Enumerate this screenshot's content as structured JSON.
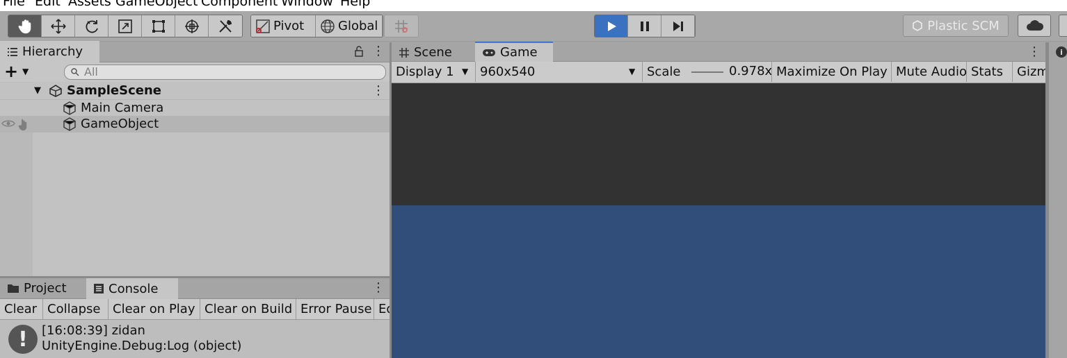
{
  "menu": [
    "File",
    "Edit",
    "Assets",
    "GameObject",
    "Component",
    "Window",
    "Help"
  ],
  "toolbar": {
    "tools": [
      "hand-tool",
      "move-tool",
      "rotate-tool",
      "scale-tool",
      "rect-tool",
      "transform-tool",
      "custom-tool"
    ],
    "pivot_label": "Pivot",
    "global_label": "Global",
    "plastic_label": "Plastic SCM"
  },
  "hierarchy": {
    "tab_label": "Hierarchy",
    "search_placeholder": "All",
    "scene_name": "SampleScene",
    "items": [
      {
        "label": "Main Camera"
      },
      {
        "label": "GameObject"
      }
    ]
  },
  "bottom": {
    "tabs": [
      {
        "label": "Project"
      },
      {
        "label": "Console"
      }
    ],
    "console_buttons": [
      "Clear",
      "Collapse",
      "Clear on Play",
      "Clear on Build",
      "Error Pause",
      "Ed"
    ],
    "log": {
      "line1": "[16:08:39] zidan",
      "line2": "UnityEngine.Debug:Log (object)"
    }
  },
  "game": {
    "tabs": [
      {
        "label": "Scene"
      },
      {
        "label": "Game"
      }
    ],
    "display": "Display 1",
    "resolution": "960x540",
    "scale_label": "Scale",
    "scale_value": "0.978x",
    "maximize": "Maximize On Play",
    "mute": "Mute Audio",
    "stats": "Stats",
    "gizmos": "Gizmos"
  },
  "colors": {
    "accent": "#3a71c1",
    "viewport_top": "#323232",
    "viewport_bottom": "#314d79"
  }
}
